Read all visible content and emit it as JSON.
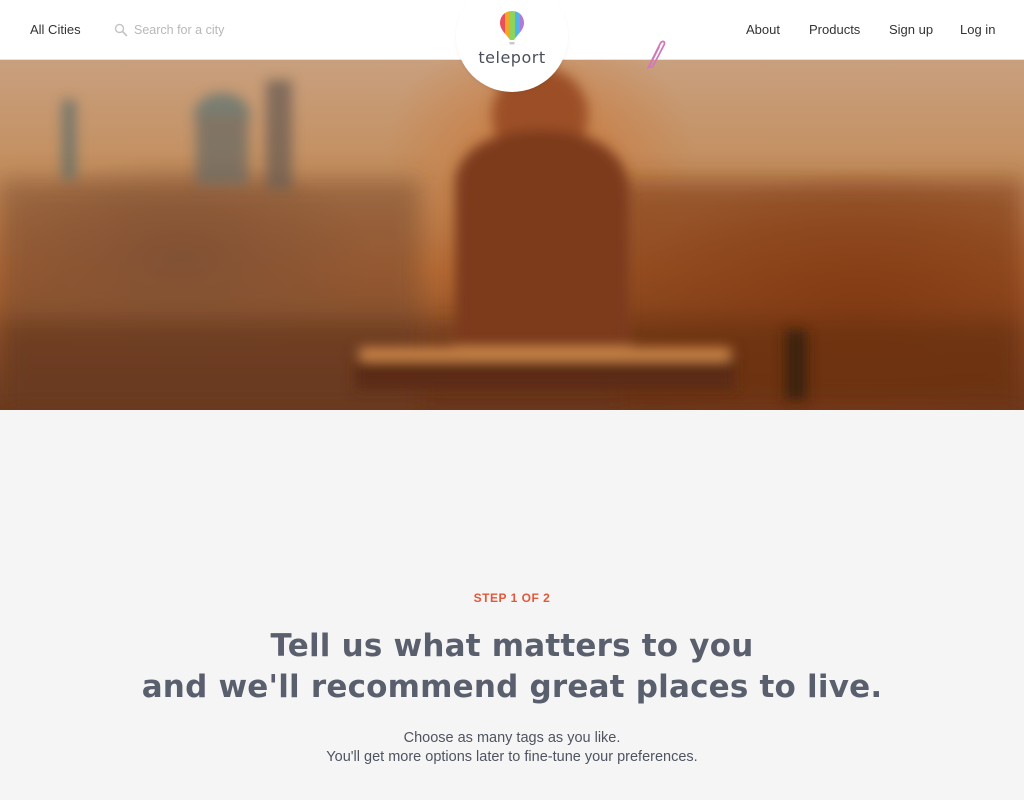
{
  "header": {
    "all_cities": "All Cities",
    "search_placeholder": "Search for a city",
    "nav": [
      "About",
      "Products",
      "Sign up",
      "Log in"
    ]
  },
  "logo": {
    "text": "teleport"
  },
  "colors": {
    "accent": "#e2583a",
    "headline": "#5a5f6e",
    "balloon": [
      "#e94f5c",
      "#f5a623",
      "#7ed321",
      "#4fb3e8",
      "#9b59b6"
    ]
  },
  "content": {
    "step": "STEP 1 OF 2",
    "headline_line1": "Tell us what matters to you",
    "headline_line2": "and we'll recommend great places to live.",
    "sub_line1": "Choose as many tags as you like.",
    "sub_line2": "You'll get more options later to fine-tune your preferences."
  }
}
